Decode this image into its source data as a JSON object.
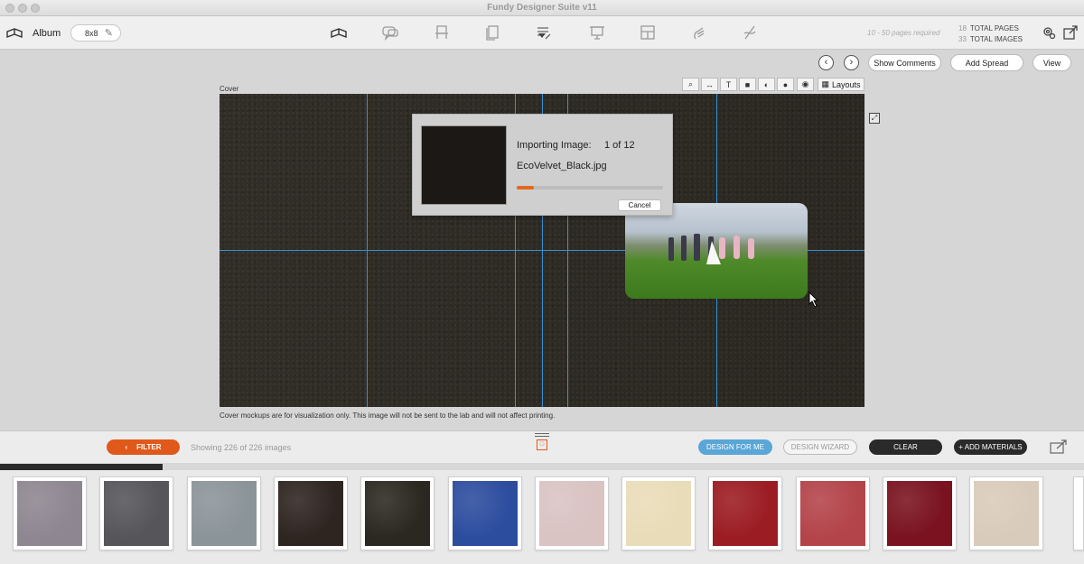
{
  "window": {
    "title": "Fundy Designer Suite v11"
  },
  "toolbar": {
    "album_label": "Album",
    "size_value": "8x8",
    "pages_required": "10 - 50 pages required",
    "total_pages_count": "18",
    "total_pages_label": "TOTAL PAGES",
    "total_images_count": "33",
    "total_images_label": "TOTAL IMAGES",
    "tool_icons": [
      "album-icon",
      "comments-icon",
      "stand-icon",
      "book-icon",
      "notes-icon",
      "presentation-icon",
      "layout-icon",
      "hand-icon",
      "sign-icon"
    ]
  },
  "canvas": {
    "show_comments": "Show Comments",
    "add_spread": "Add Spread",
    "view": "View",
    "cover_label": "Cover",
    "layouts": "Layouts",
    "disclaimer": "Cover mockups are for visualization only. This image will not be sent to the lab and will not affect printing."
  },
  "dialog": {
    "importing_label": "Importing Image:",
    "count": "1 of 12",
    "filename": "EcoVelvet_Black.jpg",
    "progress": 0.12,
    "cancel": "Cancel"
  },
  "bottombar": {
    "filter": "FILTER",
    "showing": "Showing 226 of 226 images",
    "design_for_me": "DESIGN FOR ME",
    "design_wizard": "DESIGN WIZARD",
    "clear": "CLEAR",
    "add_materials": "+ ADD MATERIALS",
    "strip_progress": 0.15
  },
  "colors": {
    "accent": "#e0591a",
    "guide": "#3a8fd6",
    "design_for_me": "#5aa6d6"
  },
  "materials": [
    {
      "name": "lavender-gray",
      "color": "#8e8690"
    },
    {
      "name": "charcoal",
      "color": "#55555a"
    },
    {
      "name": "slate",
      "color": "#8b9499"
    },
    {
      "name": "dark-brown-leather",
      "color": "#2e2420"
    },
    {
      "name": "black-velvet",
      "color": "#2a2820"
    },
    {
      "name": "royal-blue",
      "color": "#2c4c9e"
    },
    {
      "name": "blush",
      "color": "#d9c3c3"
    },
    {
      "name": "cream",
      "color": "#e9dcb8"
    },
    {
      "name": "red",
      "color": "#9b1c22"
    },
    {
      "name": "coral-red",
      "color": "#b3444a"
    },
    {
      "name": "burgundy",
      "color": "#7a1220"
    },
    {
      "name": "ivory-texture",
      "color": "#d9cbbb"
    }
  ]
}
